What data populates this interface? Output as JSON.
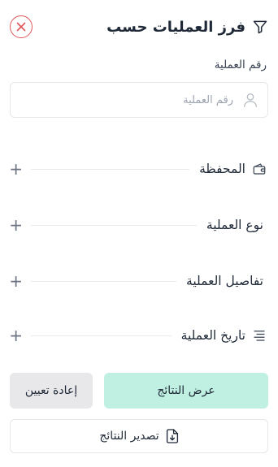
{
  "header": {
    "title": "فرز العمليات حسب",
    "filter_icon": "filter-icon",
    "close_icon": "close-icon",
    "close_color": "#e0555a"
  },
  "transaction_number": {
    "label": "رقم العملية",
    "placeholder": "رقم العملية",
    "value": "",
    "icon": "user-icon"
  },
  "sections": [
    {
      "label": "المحفظة",
      "icon": "wallet-icon",
      "expand_icon": "plus-icon"
    },
    {
      "label": "نوع العملية",
      "icon": "",
      "expand_icon": "plus-icon"
    },
    {
      "label": "تفاصيل العملية",
      "icon": "",
      "expand_icon": "plus-icon"
    },
    {
      "label": "تاريخ العملية",
      "icon": "list-icon",
      "expand_icon": "plus-icon"
    }
  ],
  "plus_symbol": "+",
  "actions": {
    "show_results": "عرض النتائج",
    "reset": "إعادة تعيين",
    "export": "تصدير النتائج",
    "export_icon": "file-download-icon",
    "primary_color": "#bff0e1",
    "secondary_color": "#e8e8ea"
  }
}
